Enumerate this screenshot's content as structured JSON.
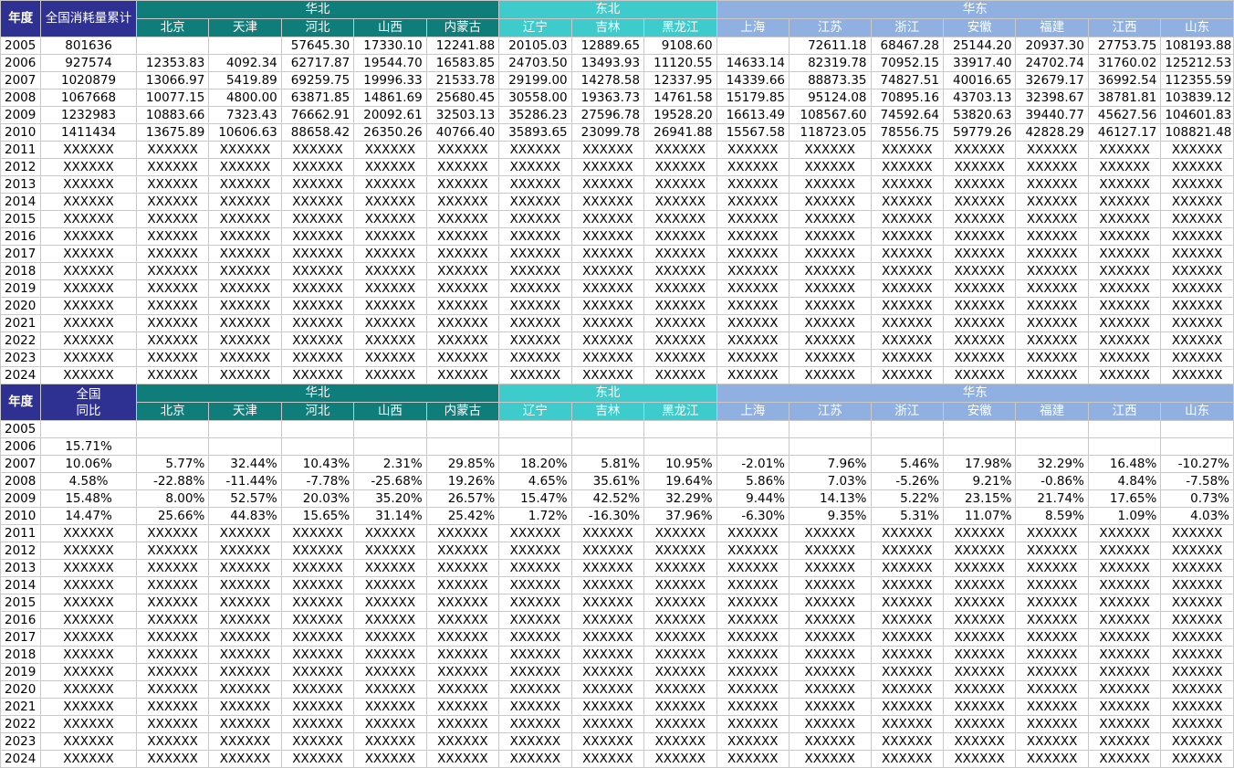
{
  "top": {
    "year_header": "年度",
    "total_header": "全国消耗量累计",
    "regions": [
      {
        "name": "华北",
        "span": 5,
        "cls": "north"
      },
      {
        "name": "东北",
        "span": 3,
        "cls": "ne"
      },
      {
        "name": "华东",
        "span": 7,
        "cls": "east"
      }
    ],
    "provinces": [
      "北京",
      "天津",
      "河北",
      "山西",
      "内蒙古",
      "辽宁",
      "吉林",
      "黑龙江",
      "上海",
      "江苏",
      "浙江",
      "安徽",
      "福建",
      "江西",
      "山东"
    ],
    "rows": [
      {
        "year": "2005",
        "total": "801636",
        "vals": [
          "",
          "",
          "57645.30",
          "17330.10",
          "12241.88",
          "20105.03",
          "12889.65",
          "9108.60",
          "",
          "72611.18",
          "68467.28",
          "25144.20",
          "20937.30",
          "27753.75",
          "108193.88"
        ]
      },
      {
        "year": "2006",
        "total": "927574",
        "vals": [
          "12353.83",
          "4092.34",
          "62717.87",
          "19544.70",
          "16583.85",
          "24703.50",
          "13493.93",
          "11120.55",
          "14633.14",
          "82319.78",
          "70952.15",
          "33917.40",
          "24702.74",
          "31760.02",
          "125212.53"
        ]
      },
      {
        "year": "2007",
        "total": "1020879",
        "vals": [
          "13066.97",
          "5419.89",
          "69259.75",
          "19996.33",
          "21533.78",
          "29199.00",
          "14278.58",
          "12337.95",
          "14339.66",
          "88873.35",
          "74827.51",
          "40016.65",
          "32679.17",
          "36992.54",
          "112355.59"
        ]
      },
      {
        "year": "2008",
        "total": "1067668",
        "vals": [
          "10077.15",
          "4800.00",
          "63871.85",
          "14861.69",
          "25680.45",
          "30558.00",
          "19363.73",
          "14761.58",
          "15179.85",
          "95124.08",
          "70895.16",
          "43703.13",
          "32398.67",
          "38781.81",
          "103839.12"
        ]
      },
      {
        "year": "2009",
        "total": "1232983",
        "vals": [
          "10883.66",
          "7323.43",
          "76662.91",
          "20092.61",
          "32503.13",
          "35286.23",
          "27596.78",
          "19528.20",
          "16613.49",
          "108567.60",
          "74592.64",
          "53820.63",
          "39440.77",
          "45627.56",
          "104601.83"
        ]
      },
      {
        "year": "2010",
        "total": "1411434",
        "vals": [
          "13675.89",
          "10606.63",
          "88658.42",
          "26350.26",
          "40766.40",
          "35893.65",
          "23099.78",
          "26941.88",
          "15567.58",
          "118723.05",
          "78556.75",
          "59779.26",
          "42828.29",
          "46127.17",
          "108821.48"
        ]
      }
    ],
    "placeholder_years": [
      "2011",
      "2012",
      "2013",
      "2014",
      "2015",
      "2016",
      "2017",
      "2018",
      "2019",
      "2020",
      "2021",
      "2022",
      "2023",
      "2024"
    ],
    "placeholder": "XXXXXX"
  },
  "bottom": {
    "year_header": "年度",
    "total_header_line1": "全国",
    "total_header_line2": "同比",
    "regions": [
      {
        "name": "华北",
        "span": 5,
        "cls": "north"
      },
      {
        "name": "东北",
        "span": 3,
        "cls": "ne"
      },
      {
        "name": "华东",
        "span": 7,
        "cls": "east"
      }
    ],
    "provinces": [
      "北京",
      "天津",
      "河北",
      "山西",
      "内蒙古",
      "辽宁",
      "吉林",
      "黑龙江",
      "上海",
      "江苏",
      "浙江",
      "安徽",
      "福建",
      "江西",
      "山东"
    ],
    "rows": [
      {
        "year": "2005",
        "total": "",
        "vals": [
          "",
          "",
          "",
          "",
          "",
          "",
          "",
          "",
          "",
          "",
          "",
          "",
          "",
          "",
          ""
        ]
      },
      {
        "year": "2006",
        "total": "15.71%",
        "vals": [
          "",
          "",
          "",
          "",
          "",
          "",
          "",
          "",
          "",
          "",
          "",
          "",
          "",
          "",
          ""
        ]
      },
      {
        "year": "2007",
        "total": "10.06%",
        "vals": [
          "5.77%",
          "32.44%",
          "10.43%",
          "2.31%",
          "29.85%",
          "18.20%",
          "5.81%",
          "10.95%",
          "-2.01%",
          "7.96%",
          "5.46%",
          "17.98%",
          "32.29%",
          "16.48%",
          "-10.27%"
        ]
      },
      {
        "year": "2008",
        "total": "4.58%",
        "vals": [
          "-22.88%",
          "-11.44%",
          "-7.78%",
          "-25.68%",
          "19.26%",
          "4.65%",
          "35.61%",
          "19.64%",
          "5.86%",
          "7.03%",
          "-5.26%",
          "9.21%",
          "-0.86%",
          "4.84%",
          "-7.58%"
        ]
      },
      {
        "year": "2009",
        "total": "15.48%",
        "vals": [
          "8.00%",
          "52.57%",
          "20.03%",
          "35.20%",
          "26.57%",
          "15.47%",
          "42.52%",
          "32.29%",
          "9.44%",
          "14.13%",
          "5.22%",
          "23.15%",
          "21.74%",
          "17.65%",
          "0.73%"
        ]
      },
      {
        "year": "2010",
        "total": "14.47%",
        "vals": [
          "25.66%",
          "44.83%",
          "15.65%",
          "31.14%",
          "25.42%",
          "1.72%",
          "-16.30%",
          "37.96%",
          "-6.30%",
          "9.35%",
          "5.31%",
          "11.07%",
          "8.59%",
          "1.09%",
          "4.03%"
        ]
      }
    ],
    "placeholder_years": [
      "2011",
      "2012",
      "2013",
      "2014",
      "2015",
      "2016",
      "2017",
      "2018",
      "2019",
      "2020",
      "2021",
      "2022",
      "2023",
      "2024"
    ],
    "placeholder": "XXXXXX"
  },
  "colors": {
    "year_header": "#2e3192",
    "north": "#0f7e7b",
    "northeast": "#3ecbcb",
    "east": "#8fb0e0"
  }
}
